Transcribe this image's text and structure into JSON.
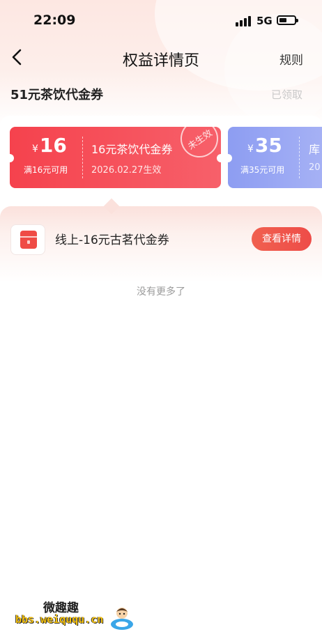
{
  "status_bar": {
    "time": "22:09",
    "network": "5G"
  },
  "nav": {
    "title": "权益详情页",
    "rules_label": "规则"
  },
  "coupon": {
    "title": "51元茶饮代金券",
    "claim_status": "已领取"
  },
  "tickets": [
    {
      "currency": "¥",
      "amount": "16",
      "min_spend": "满16元可用",
      "name": "16元茶饮代金券",
      "date": "2026.02.27生效",
      "stamp": "未生效",
      "color": "#f5424d"
    },
    {
      "currency": "¥",
      "amount": "35",
      "min_spend": "满35元可用",
      "name": "库",
      "date": "20",
      "color": "#8d9df2"
    }
  ],
  "product": {
    "name": "线上-16元古茗代金券",
    "button_label": "查看详情",
    "icon": "shop-box-icon"
  },
  "list_end_text": "没有更多了",
  "watermark": {
    "title": "微趣趣",
    "url": "bbs.weiququ.cn"
  },
  "colors": {
    "accent_red": "#f5424d",
    "accent_blue": "#8d9df2",
    "button_red": "#ee4c48"
  }
}
